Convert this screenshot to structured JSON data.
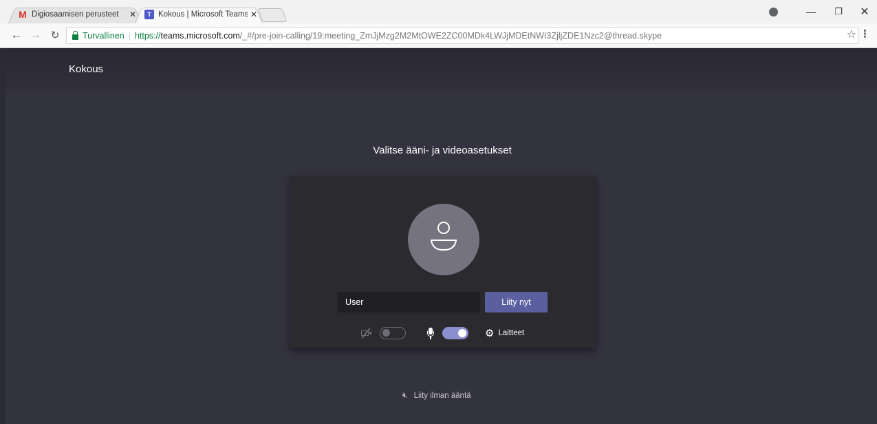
{
  "browser": {
    "tabs": [
      {
        "title": "Digiosaamisen perusteet",
        "icon": "gmail-icon",
        "close": "✕"
      },
      {
        "title": "Kokous | Microsoft Teams",
        "icon": "teams-icon",
        "close": "✕"
      }
    ],
    "address": {
      "secure_label": "Turvallinen",
      "scheme": "https://",
      "host": "teams.microsoft.com",
      "path": "/_#/pre-join-calling/19:meeting_ZmJjMzg2M2MtOWE2ZC00MDk4LWJjMDEtNWI3ZjljZDE1Nzc2@thread.skype"
    }
  },
  "teams": {
    "page_title": "Kokous",
    "setup_title": "Valitse ääni- ja videoasetukset",
    "name_value": "User",
    "join_label": "Liity nyt",
    "devices_label": "Laitteet",
    "join_without_audio_label": "Liity ilman ääntä",
    "video_enabled": false,
    "mic_enabled": true,
    "colors": {
      "accent": "#5b5fa0",
      "toggle_on": "#8b8fcf",
      "background": "#33323f",
      "panel": "#2b2a2f"
    }
  }
}
